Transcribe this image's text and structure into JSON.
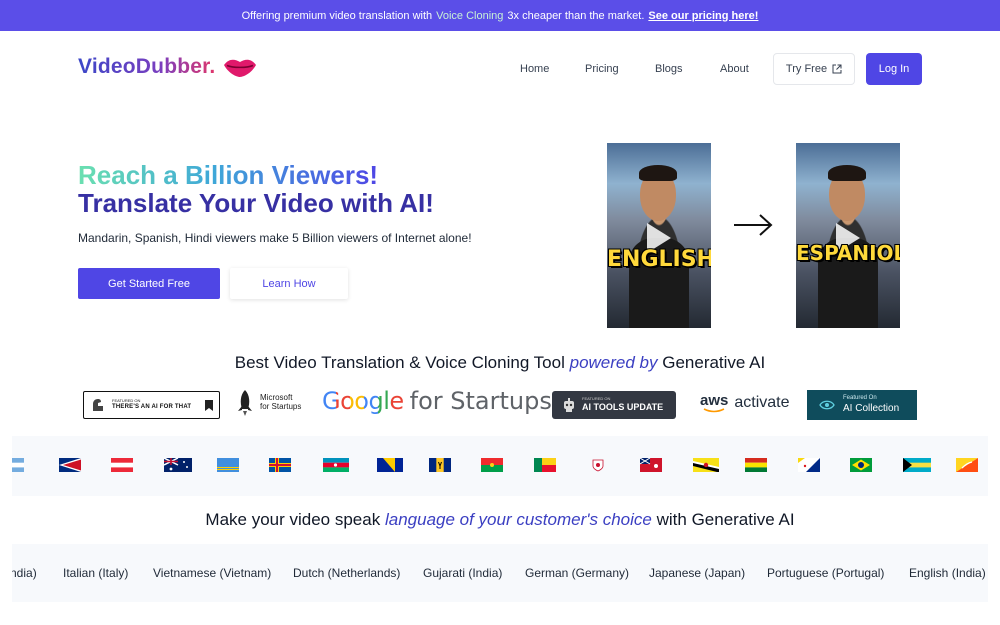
{
  "banner": {
    "text_before": "Offering premium video translation with",
    "highlight": "Voice Cloning",
    "text_after": "3x cheaper than the market.",
    "link": "See our pricing here!"
  },
  "logo": {
    "text": "VideoDubber.",
    "icon": "lips-icon"
  },
  "nav": {
    "home": "Home",
    "pricing": "Pricing",
    "blogs": "Blogs",
    "about": "About",
    "try_free": "Try Free",
    "login": "Log In"
  },
  "hero": {
    "line1": "Reach a Billion Viewers!",
    "line2": "Translate Your Video with AI!",
    "subtitle": "Mandarin, Spanish, Hindi viewers make 5 Billion viewers of Internet alone!",
    "cta_primary": "Get Started Free",
    "cta_secondary": "Learn How"
  },
  "videos": {
    "source_caption": "ENGLISH",
    "target_caption": "ESPANIOL"
  },
  "tagline": {
    "before": "Best Video Translation & Voice Cloning Tool",
    "emphasis": "powered by",
    "after": "Generative AI"
  },
  "badges": {
    "aiforthat_small": "FEATURED ON",
    "aiforthat_big": "THERE'S AN AI FOR THAT",
    "microsoft_line1": "Microsoft",
    "microsoft_line2": "for Startups",
    "google_brand": "Google",
    "google_suffix": "for Startups",
    "aitools_small": "FEATURED ON",
    "aitools_big": "AI TOOLS UPDATE",
    "aws_brand": "aws",
    "aws_suffix": "activate",
    "aicollection_small": "Featured On",
    "aicollection_big": "AI Collection"
  },
  "flags": [
    "argentina",
    "american-samoa",
    "austria",
    "australia",
    "aruba",
    "aland",
    "azerbaijan",
    "bosnia",
    "barbados",
    "burkina-faso",
    "benin",
    "bermuda-crest",
    "bermuda",
    "brunei",
    "bolivia",
    "bonaire",
    "brazil",
    "bahamas",
    "bhutan"
  ],
  "tagline2": {
    "before": "Make your video speak",
    "emphasis": "language of your customer's choice",
    "after": "with Generative AI"
  },
  "languages": [
    "ndia)",
    "Italian (Italy)",
    "Vietnamese (Vietnam)",
    "Dutch (Netherlands)",
    "Gujarati (India)",
    "German (Germany)",
    "Japanese (Japan)",
    "Portuguese (Portugal)",
    "English (India)"
  ],
  "colors": {
    "primary": "#4f46e5",
    "banner": "#5b4ee8",
    "heading_dark": "#3730a3"
  }
}
